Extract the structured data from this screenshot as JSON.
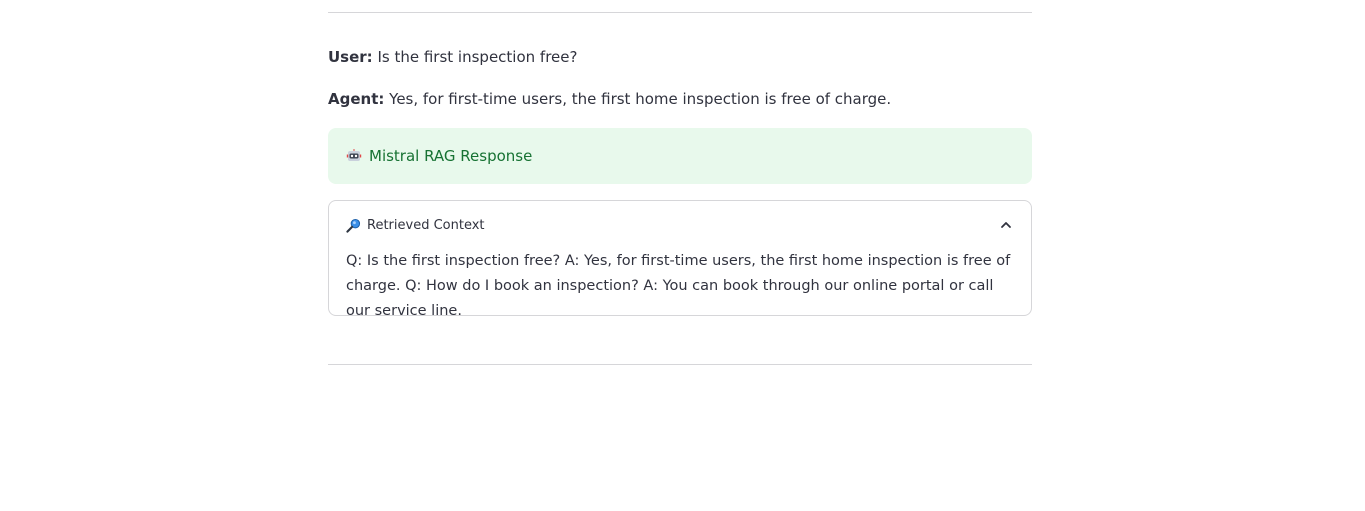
{
  "conversation": {
    "user_label": "User:",
    "user_text": " Is the first inspection free?",
    "agent_label": "Agent:",
    "agent_text": " Yes, for first-time users, the first home inspection is free of charge."
  },
  "success_box": {
    "icon": "robot-icon",
    "text": "Mistral RAG Response"
  },
  "expander": {
    "icon": "magnifier-icon",
    "title": "Retrieved Context",
    "chevron": "chevron-up-icon",
    "body": "Q: Is the first inspection free? A: Yes, for first-time users, the first home inspection is free of charge. Q: How do I book an inspection? A: You can book through our online portal or call our service line."
  },
  "colors": {
    "success_bg": "#e8f9ec",
    "success_text": "#177233",
    "divider": "#d6d6d9",
    "text": "#31333f"
  }
}
